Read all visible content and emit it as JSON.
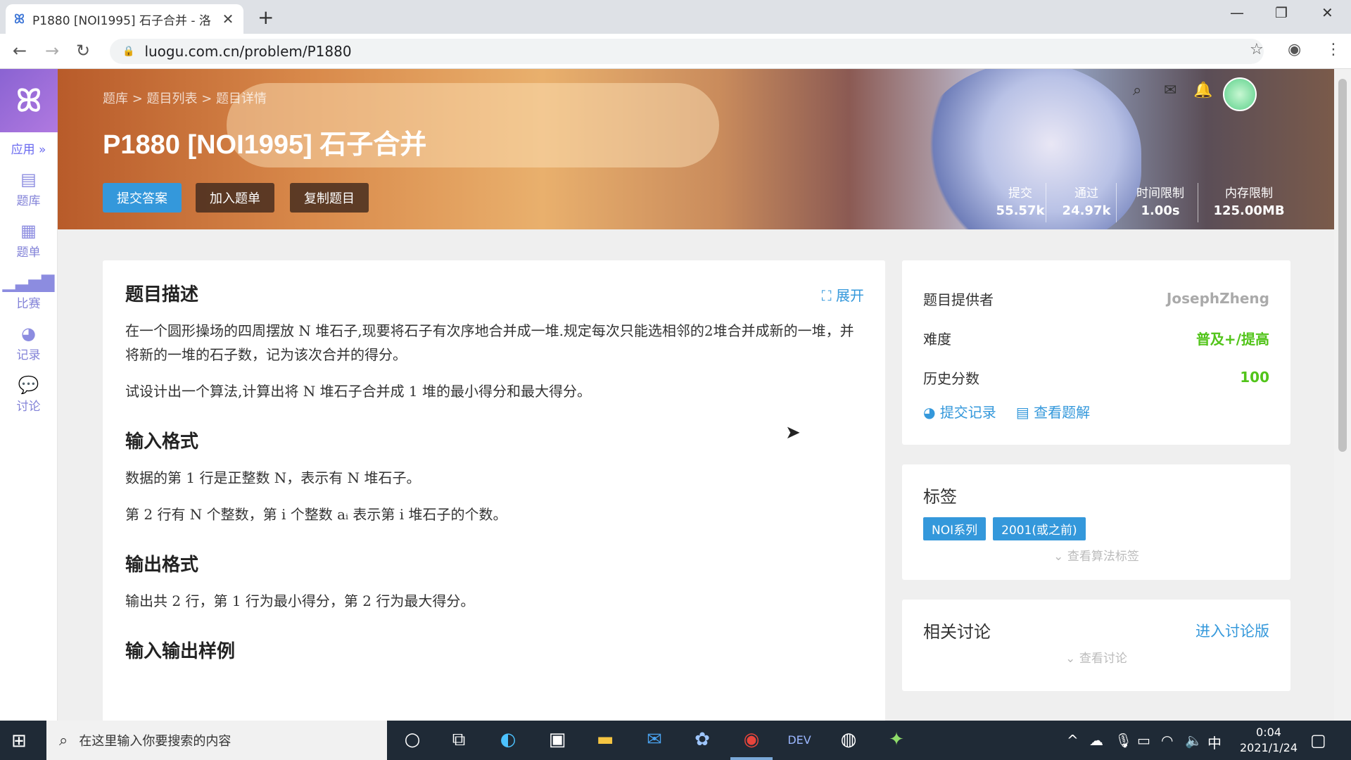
{
  "browser": {
    "tab_title": "P1880 [NOI1995] 石子合并 - 洛",
    "url": "luogu.com.cn/problem/P1880"
  },
  "sidebar": {
    "apps_label": "应用 »",
    "items": [
      {
        "label": "题库",
        "icon": "book-icon"
      },
      {
        "label": "题单",
        "icon": "clipboard-icon"
      },
      {
        "label": "比赛",
        "icon": "bar-chart-icon"
      },
      {
        "label": "记录",
        "icon": "pie-chart-icon"
      },
      {
        "label": "讨论",
        "icon": "chat-icon"
      }
    ]
  },
  "banner": {
    "breadcrumb": "题库 > 题目列表 > 题目详情",
    "title": "P1880 [NOI1995] 石子合并",
    "buttons": {
      "submit": "提交答案",
      "add_list": "加入题单",
      "copy": "复制题目"
    },
    "stats": [
      {
        "label": "提交",
        "value": "55.57k"
      },
      {
        "label": "通过",
        "value": "24.97k"
      },
      {
        "label": "时间限制",
        "value": "1.00s"
      },
      {
        "label": "内存限制",
        "value": "125.00MB"
      }
    ]
  },
  "problem": {
    "expand": "展开",
    "desc_heading": "题目描述",
    "desc_p1": "在一个圆形操场的四周摆放 N 堆石子,现要将石子有次序地合并成一堆.规定每次只能选相邻的2堆合并成新的一堆，并将新的一堆的石子数，记为该次合并的得分。",
    "desc_p2": "试设计出一个算法,计算出将 N 堆石子合并成 1 堆的最小得分和最大得分。",
    "input_heading": "输入格式",
    "input_p1": "数据的第 1 行是正整数 N，表示有 N 堆石子。",
    "input_p2": "第 2 行有 N 个整数，第 i 个整数 aᵢ 表示第 i 堆石子的个数。",
    "output_heading": "输出格式",
    "output_p1": "输出共 2 行，第 1 行为最小得分，第 2 行为最大得分。",
    "sample_heading": "输入输出样例"
  },
  "info": {
    "provider_label": "题目提供者",
    "provider_value": "JosephZheng",
    "difficulty_label": "难度",
    "difficulty_value": "普及+/提高",
    "history_label": "历史分数",
    "history_value": "100",
    "link_records": "提交记录",
    "link_solutions": "查看题解"
  },
  "tags": {
    "heading": "标签",
    "items": [
      "NOI系列",
      "2001(或之前)"
    ],
    "show_algo": "查看算法标签"
  },
  "discussion": {
    "heading": "相关讨论",
    "enter": "进入讨论版",
    "show": "查看讨论"
  },
  "taskbar": {
    "search_placeholder": "在这里输入你要搜索的内容",
    "ime": "中",
    "time": "0:04",
    "date": "2021/1/24"
  },
  "colors": {
    "accent": "#3498db",
    "green": "#52c41a",
    "sidebar_purple": "#8a63d2"
  }
}
